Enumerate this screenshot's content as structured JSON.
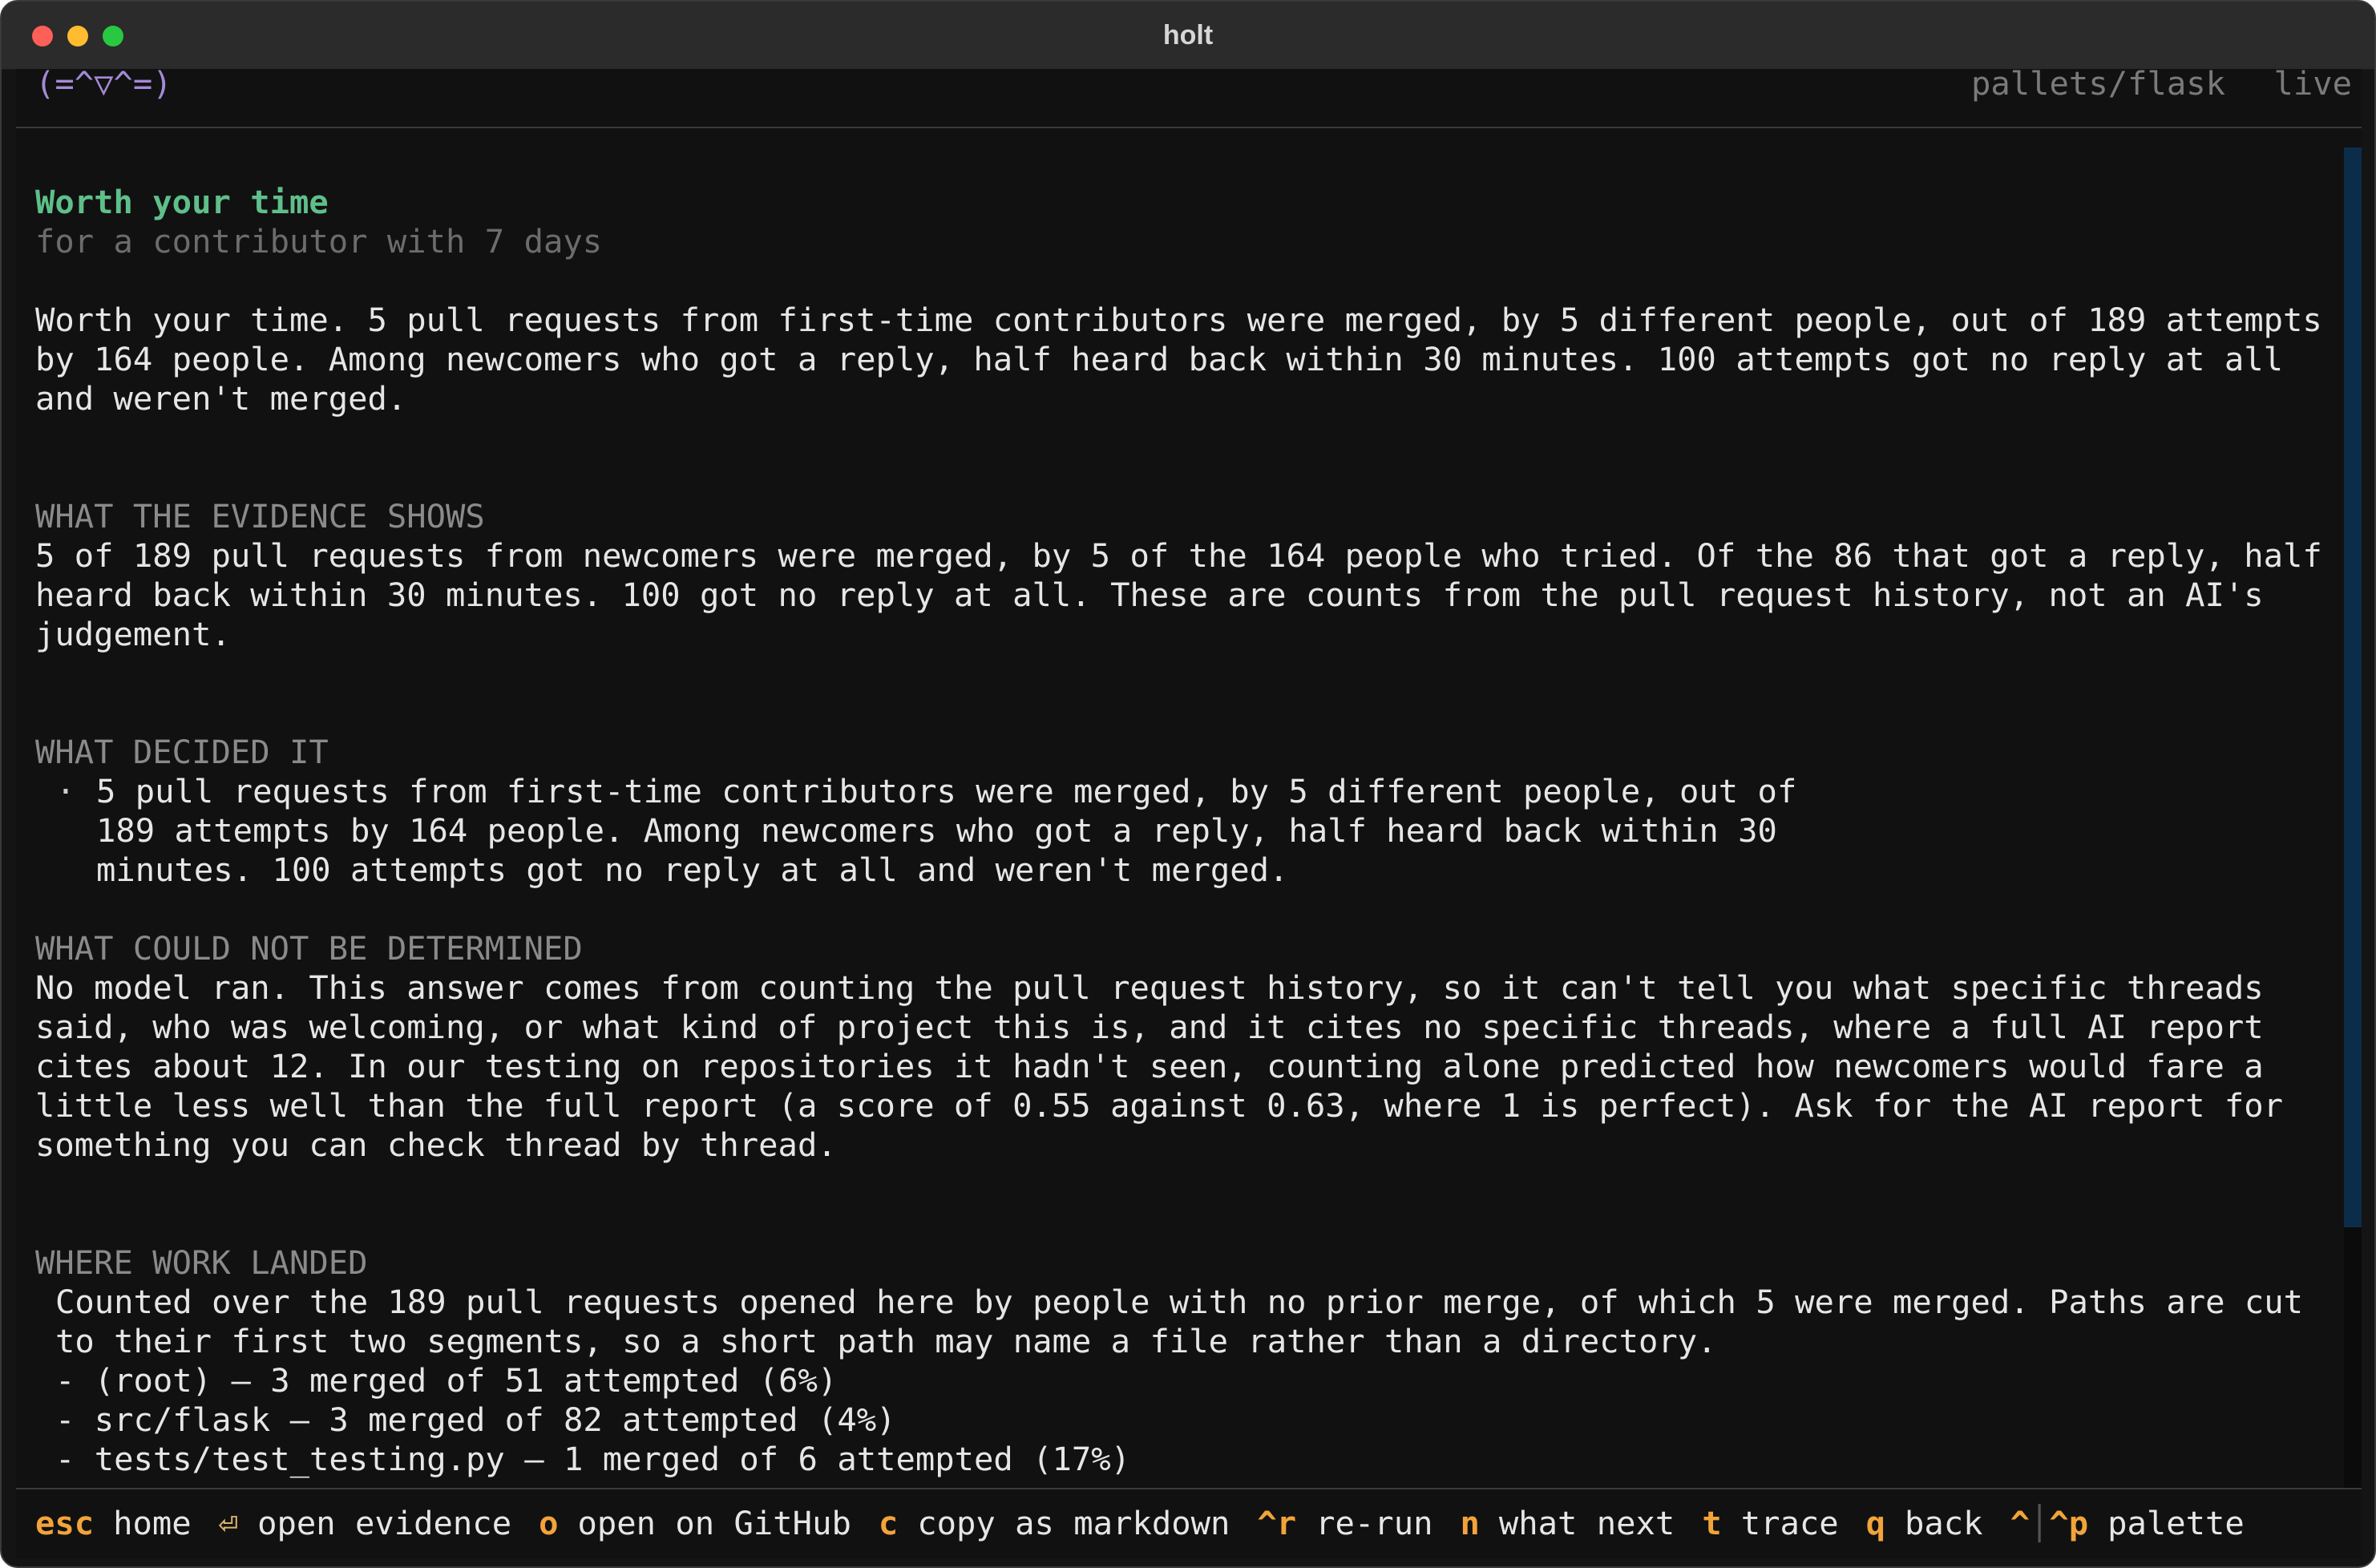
{
  "window": {
    "title": "holt"
  },
  "topbar": {
    "mascot": "(=^▽^=)",
    "repo": "pallets/flask",
    "status": "live"
  },
  "report": {
    "title": "Worth your time",
    "subtitle": "for a contributor with 7 days",
    "summary": "Worth your time. 5 pull requests from first-time contributors were merged, by 5 different people, out of 189 attempts by 164 people. Among newcomers who got a reply, half heard back within 30 minutes. 100 attempts got no reply at all and weren't merged.",
    "evidence": {
      "label": "WHAT THE EVIDENCE SHOWS",
      "text": "5 of 189 pull requests from newcomers were merged, by 5 of the 164 people who tried. Of the 86 that got a reply, half heard back within 30 minutes. 100 got no reply at all. These are counts from the pull request history, not an AI's judgement."
    },
    "decided": {
      "label": "WHAT DECIDED IT",
      "bullet": "·",
      "items": [
        "5 pull requests from first-time contributors were merged, by 5 different people, out of 189 attempts by 164 people. Among newcomers who got a reply, half heard back within 30 minutes. 100 attempts got no reply at all and weren't merged."
      ]
    },
    "undetermined": {
      "label": "WHAT COULD NOT BE DETERMINED",
      "text": "No model ran. This answer comes from counting the pull request history, so it can't tell you what specific threads said, who was welcoming, or what kind of project this is, and it cites no specific threads, where a full AI report cites about 12. In our testing on repositories it hadn't seen, counting alone predicted how newcomers would fare a little less well than the full report (a score of 0.55 against 0.63, where 1 is perfect). Ask for the AI report for something you can check thread by thread."
    },
    "landed": {
      "label": "WHERE WORK LANDED",
      "intro": "Counted over the 189 pull requests opened here by people with no prior merge, of which 5 were merged. Paths are cut to their first two segments, so a short path may name a file rather than a directory.",
      "rows": [
        "- (root) — 3 merged of 51 attempted (6%)",
        "- src/flask — 3 merged of 82 attempted (4%)",
        "- tests/test_testing.py — 1 merged of 6 attempted (17%)"
      ]
    }
  },
  "scrollbar": {
    "position_fraction": 0,
    "visible_fraction": 0.77
  },
  "footer": {
    "shortcuts": [
      {
        "key": "esc",
        "label": "home"
      },
      {
        "key": "⏎",
        "label": "open evidence"
      },
      {
        "key": "o",
        "label": "open on GitHub"
      },
      {
        "key": "c",
        "label": "copy as markdown"
      },
      {
        "key": "^r",
        "label": "re-run"
      },
      {
        "key": "n",
        "label": "what next"
      },
      {
        "key": "t",
        "label": "trace"
      },
      {
        "key": "q",
        "label": "back"
      },
      {
        "key": "^",
        "label": ""
      },
      {
        "key": "^p",
        "label": "palette"
      }
    ]
  },
  "colors": {
    "background": "#111111",
    "heading": "#5fbf8a",
    "muted": "#6c6c6c",
    "section": "#8a8a8a",
    "key": "#f2a33a",
    "mascot": "#a48ad6",
    "scroll_thumb": "#0b2d4a"
  },
  "icons": {
    "enter": "return-key-icon"
  }
}
